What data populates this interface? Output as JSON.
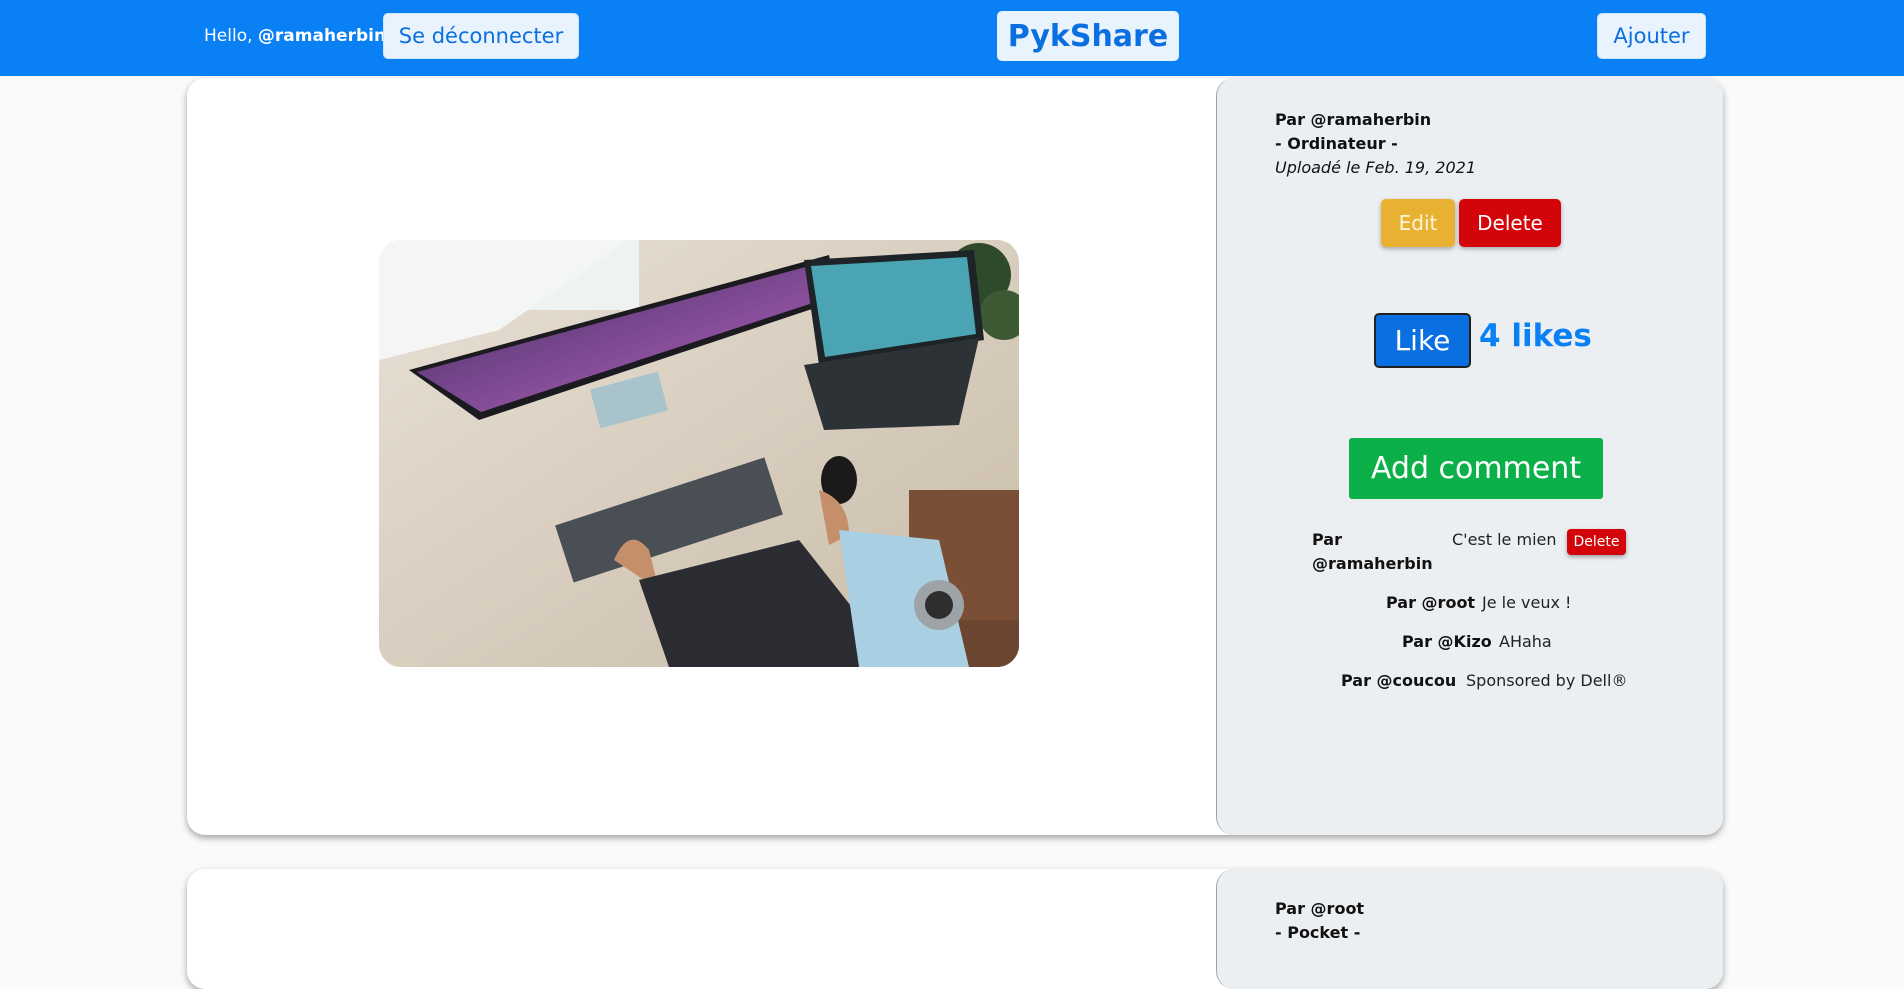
{
  "header": {
    "hello_prefix": "Hello,",
    "username": "@ramaherbin",
    "logout_label": "Se déconnecter",
    "brand": "PykShare",
    "add_label": "Ajouter"
  },
  "posts": [
    {
      "author": "Par @ramaherbin",
      "category": "- Ordinateur -",
      "uploaded": "Uploadé le Feb. 19, 2021",
      "edit_label": "Edit",
      "delete_label": "Delete",
      "like_label": "Like",
      "likes_text": "4 likes",
      "add_comment_label": "Add comment",
      "comments": [
        {
          "author": "Par @ramaherbin",
          "text": "C'est le mien",
          "delete_label": "Delete"
        },
        {
          "author": "Par @root",
          "text": "Je le veux !"
        },
        {
          "author": "Par @Kizo",
          "text": "AHaha"
        },
        {
          "author": "Par @coucou",
          "text": "Sponsored by Dell®"
        }
      ]
    },
    {
      "author": "Par @root",
      "category": "- Pocket -"
    }
  ],
  "colors": {
    "nav": "#0a80f5",
    "edit": "#e8b132",
    "delete": "#d3040a",
    "like": "#0a6fe0",
    "add_comment": "#0bb148"
  }
}
